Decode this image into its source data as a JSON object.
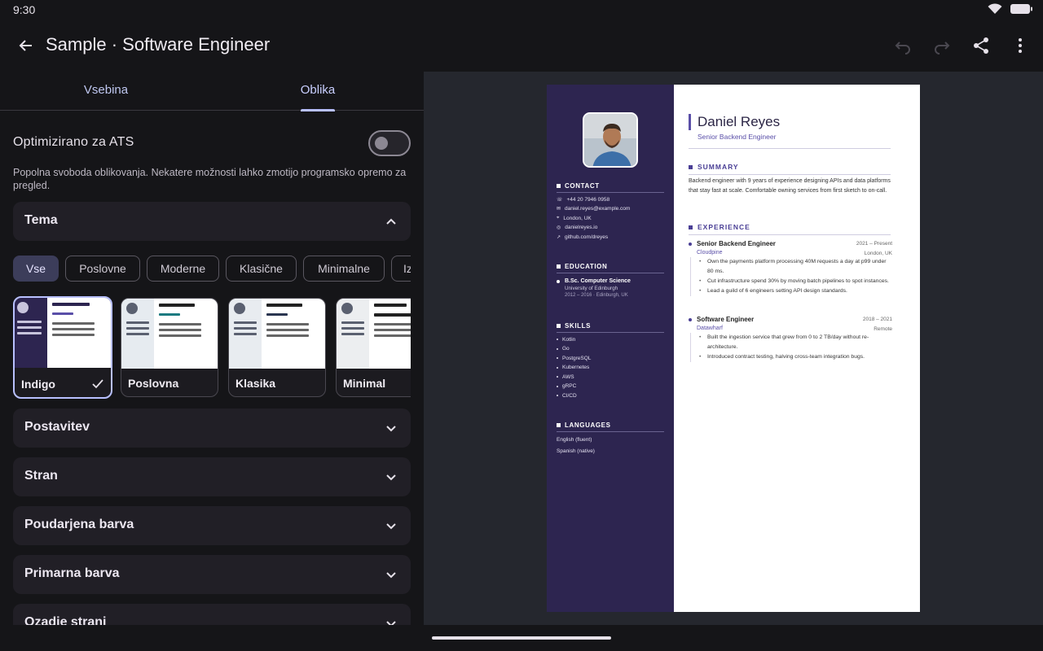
{
  "status": {
    "time": "9:30"
  },
  "appbar": {
    "title": "Sample · Software Engineer"
  },
  "tabs": [
    {
      "label": "Vsebina"
    },
    {
      "label": "Oblika"
    }
  ],
  "ats": {
    "label": "Optimizirano za ATS",
    "enabled": false,
    "description": "Popolna svoboda oblikovanja. Nekatere možnosti lahko zmotijo programsko opremo za pregled."
  },
  "sections": {
    "tema": "Tema",
    "postavitev": "Postavitev",
    "stran": "Stran",
    "poudarjena": "Poudarjena barva",
    "primarna": "Primarna barva",
    "ozadje": "Ozadje strani"
  },
  "filters": [
    "Vse",
    "Poslovne",
    "Moderne",
    "Klasične",
    "Minimalne",
    "Iz"
  ],
  "themes": [
    {
      "name": "Indigo",
      "selected": true
    },
    {
      "name": "Poslovna",
      "selected": false
    },
    {
      "name": "Klasika",
      "selected": false
    },
    {
      "name": "Minimal",
      "selected": false
    }
  ],
  "resume": {
    "name": "Daniel Reyes",
    "role": "Senior Backend Engineer",
    "contact_title": "CONTACT",
    "contact": [
      "+44 20 7946 0958",
      "daniel.reyes@example.com",
      "London, UK",
      "danielreyes.io",
      "github.com/dreyes"
    ],
    "education_title": "EDUCATION",
    "education": {
      "degree": "B.Sc. Computer Science",
      "school": "University of Edinburgh",
      "dates": "2012 – 2016 · Edinburgh, UK"
    },
    "skills_title": "SKILLS",
    "skills": [
      "Kotlin",
      "Go",
      "PostgreSQL",
      "Kubernetes",
      "AWS",
      "gRPC",
      "CI/CD"
    ],
    "languages_title": "LANGUAGES",
    "languages": [
      "English (fluent)",
      "Spanish (native)"
    ],
    "summary_title": "SUMMARY",
    "summary": "Backend engineer with 9 years of experience designing APIs and data platforms that stay fast at scale. Comfortable owning services from first sketch to on-call.",
    "experience_title": "EXPERIENCE",
    "jobs": [
      {
        "title": "Senior Backend Engineer",
        "dates": "2021 – Present",
        "company": "Cloudpine",
        "location": "London, UK",
        "bullets": [
          "Own the payments platform processing 40M requests a day at p99 under 80 ms.",
          "Cut infrastructure spend 30% by moving batch pipelines to spot instances.",
          "Lead a guild of 6 engineers setting API design standards."
        ]
      },
      {
        "title": "Software Engineer",
        "dates": "2018 – 2021",
        "company": "Datawharf",
        "location": "Remote",
        "bullets": [
          "Built the ingestion service that grew from 0 to 2 TB/day without re-architecture.",
          "Introduced contract testing, halving cross-team integration bugs."
        ]
      }
    ]
  }
}
